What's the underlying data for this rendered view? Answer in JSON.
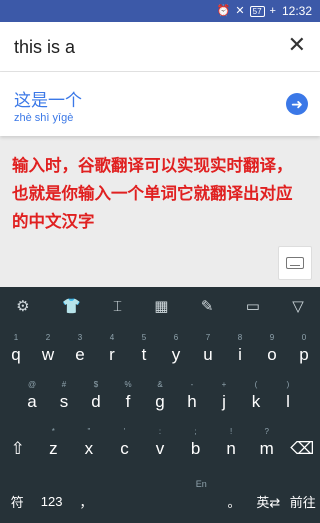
{
  "status_bar": {
    "time": "12:32",
    "battery": "57",
    "icons": [
      "alarm-icon",
      "mute-icon",
      "battery-icon",
      "charging-icon"
    ]
  },
  "input": {
    "query": "this is a",
    "close_icon": "close-icon"
  },
  "result": {
    "translation": "这是一个",
    "pinyin": "zhè shì yīgè",
    "go_icon": "arrow-right-icon"
  },
  "annotation": "输入时，谷歌翻译可以实现实时翻译，也就是你输入一个单词它就翻译出对应的中文汉字",
  "keyboard": {
    "toolbar_icons": [
      "settings-icon",
      "shirt-icon",
      "cursor-icon",
      "keypad-grid-icon",
      "handwriting-icon",
      "message-icon",
      "collapse-icon"
    ],
    "row1": [
      {
        "k": "q",
        "h": "1"
      },
      {
        "k": "w",
        "h": "2"
      },
      {
        "k": "e",
        "h": "3"
      },
      {
        "k": "r",
        "h": "4"
      },
      {
        "k": "t",
        "h": "5"
      },
      {
        "k": "y",
        "h": "6"
      },
      {
        "k": "u",
        "h": "7"
      },
      {
        "k": "i",
        "h": "8"
      },
      {
        "k": "o",
        "h": "9"
      },
      {
        "k": "p",
        "h": "0"
      }
    ],
    "row2": [
      {
        "k": "a",
        "h": "@"
      },
      {
        "k": "s",
        "h": "#"
      },
      {
        "k": "d",
        "h": "$"
      },
      {
        "k": "f",
        "h": "%"
      },
      {
        "k": "g",
        "h": "&"
      },
      {
        "k": "h",
        "h": "-"
      },
      {
        "k": "j",
        "h": "+"
      },
      {
        "k": "k",
        "h": "("
      },
      {
        "k": "l",
        "h": ")"
      }
    ],
    "row3": [
      {
        "k": "⇧",
        "h": ""
      },
      {
        "k": "z",
        "h": "*"
      },
      {
        "k": "x",
        "h": "\""
      },
      {
        "k": "c",
        "h": "'"
      },
      {
        "k": "v",
        "h": ":"
      },
      {
        "k": "b",
        "h": ";"
      },
      {
        "k": "n",
        "h": "!"
      },
      {
        "k": "m",
        "h": "?"
      },
      {
        "k": "⌫",
        "h": ""
      }
    ],
    "row4": {
      "symbol": "符",
      "numbers": "123",
      "comma": "，",
      "space_hint": "En",
      "period": "。",
      "lang": "英",
      "lang_arrow": "⇄",
      "enter": "前往"
    }
  },
  "colors": {
    "status_bar": "#3c59a8",
    "accent": "#3b78e7",
    "annotation": "#e02020",
    "keyboard_bg": "#263238"
  }
}
